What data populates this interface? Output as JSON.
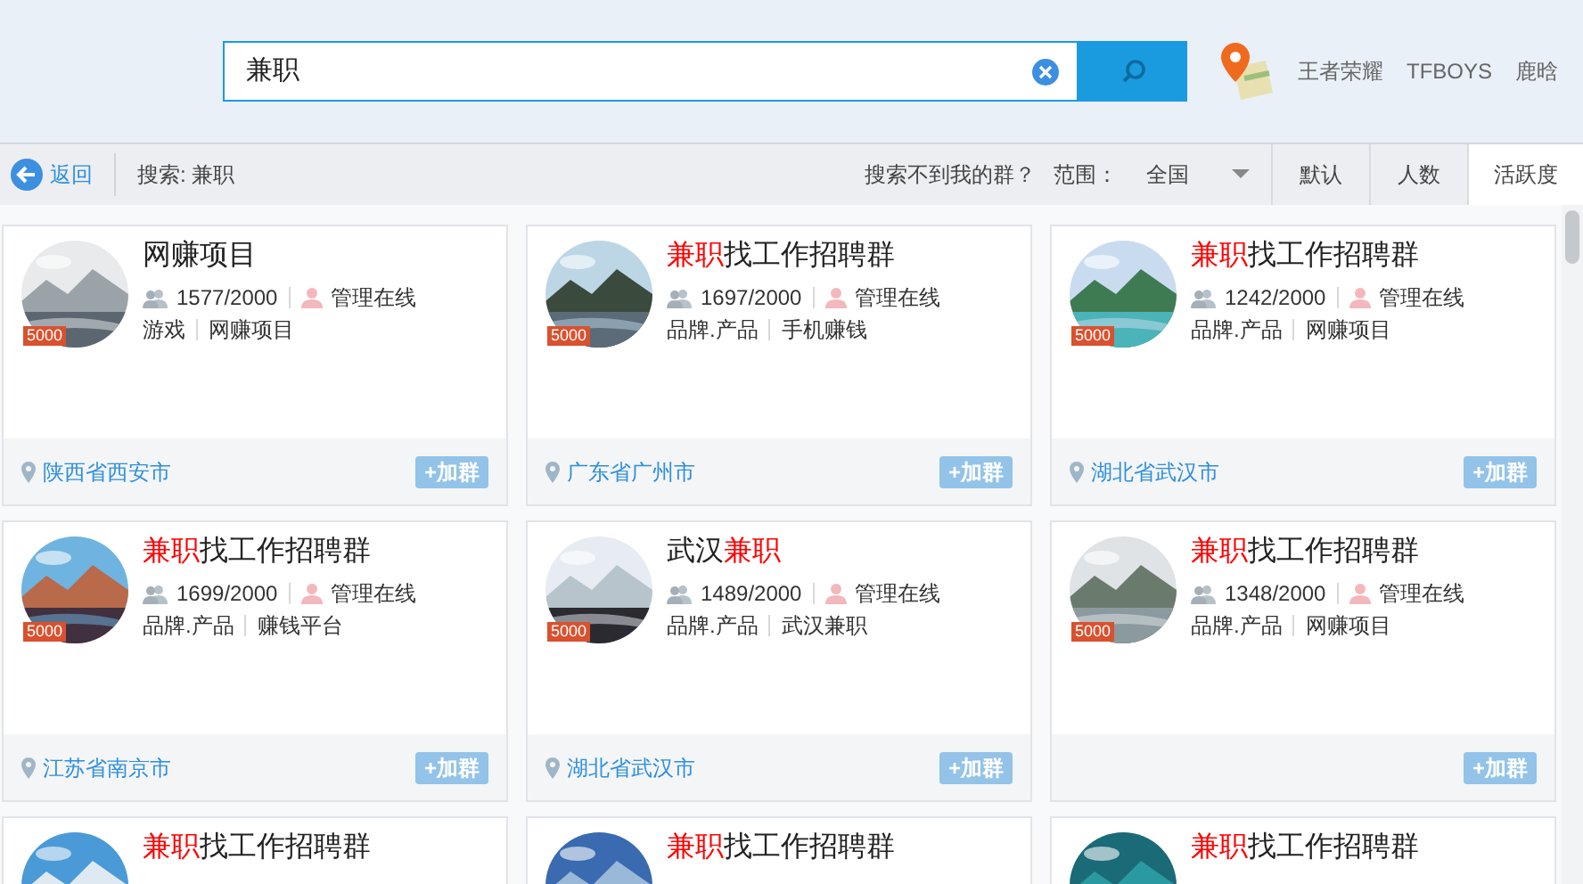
{
  "search": {
    "value": "兼职"
  },
  "hot_words": [
    "王者荣耀",
    "TFBOYS",
    "鹿晗"
  ],
  "toolbar": {
    "back": "返回",
    "query": "搜索: 兼职",
    "not_found": "搜索不到我的群？",
    "range_label": "范围：",
    "range_value": "全国"
  },
  "sort_tabs": [
    {
      "label": "默认",
      "selected": false
    },
    {
      "label": "人数",
      "selected": false
    },
    {
      "label": "活跃度",
      "selected": true
    }
  ],
  "groups": [
    {
      "title": [
        {
          "text": "网赚项目",
          "highlight": false
        }
      ],
      "badge": "5000",
      "members": "1577/2000",
      "admin": "管理在线",
      "tags": [
        "游戏",
        "网赚项目"
      ],
      "location": "陕西省西安市",
      "join": "+加群"
    },
    {
      "title": [
        {
          "text": "兼职",
          "highlight": true
        },
        {
          "text": "找工作招聘群",
          "highlight": false
        }
      ],
      "badge": "5000",
      "members": "1697/2000",
      "admin": "管理在线",
      "tags": [
        "品牌.产品",
        "手机赚钱"
      ],
      "location": "广东省广州市",
      "join": "+加群"
    },
    {
      "title": [
        {
          "text": "兼职",
          "highlight": true
        },
        {
          "text": "找工作招聘群",
          "highlight": false
        }
      ],
      "badge": "5000",
      "members": "1242/2000",
      "admin": "管理在线",
      "tags": [
        "品牌.产品",
        "网赚项目"
      ],
      "location": "湖北省武汉市",
      "join": "+加群"
    },
    {
      "title": [
        {
          "text": "兼职",
          "highlight": true
        },
        {
          "text": "找工作招聘群",
          "highlight": false
        }
      ],
      "badge": "5000",
      "members": "1699/2000",
      "admin": "管理在线",
      "tags": [
        "品牌.产品",
        "赚钱平台"
      ],
      "location": "江苏省南京市",
      "join": "+加群"
    },
    {
      "title": [
        {
          "text": "武汉",
          "highlight": false
        },
        {
          "text": "兼职",
          "highlight": true
        }
      ],
      "badge": "5000",
      "members": "1489/2000",
      "admin": "管理在线",
      "tags": [
        "品牌.产品",
        "武汉兼职"
      ],
      "location": "湖北省武汉市",
      "join": "+加群"
    },
    {
      "title": [
        {
          "text": "兼职",
          "highlight": true
        },
        {
          "text": "找工作招聘群",
          "highlight": false
        }
      ],
      "badge": "5000",
      "members": "1348/2000",
      "admin": "管理在线",
      "tags": [
        "品牌.产品",
        "网赚项目"
      ],
      "join": "+加群"
    },
    {
      "title": [
        {
          "text": "兼职",
          "highlight": true
        },
        {
          "text": "找工作招聘群",
          "highlight": false
        }
      ]
    },
    {
      "title": [
        {
          "text": "兼职",
          "highlight": true
        },
        {
          "text": "找工作招聘群",
          "highlight": false
        }
      ]
    },
    {
      "title": [
        {
          "text": "兼职",
          "highlight": true
        },
        {
          "text": "找工作招聘群",
          "highlight": false
        }
      ]
    }
  ]
}
